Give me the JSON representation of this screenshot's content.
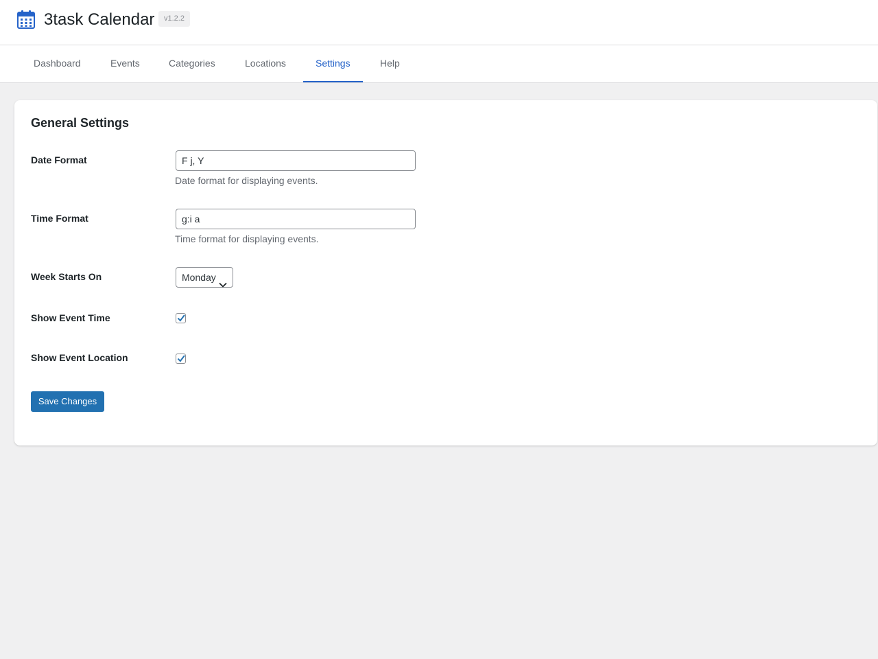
{
  "app": {
    "title": "3task Calendar",
    "version": "v1.2.2",
    "logo_icon": "calendar-icon",
    "accent_color": "#2563c9"
  },
  "nav": {
    "tabs": [
      {
        "label": "Dashboard",
        "active": false
      },
      {
        "label": "Events",
        "active": false
      },
      {
        "label": "Categories",
        "active": false
      },
      {
        "label": "Locations",
        "active": false
      },
      {
        "label": "Settings",
        "active": true
      },
      {
        "label": "Help",
        "active": false
      }
    ]
  },
  "settings": {
    "title": "General Settings",
    "date_format": {
      "label": "Date Format",
      "value": "F j, Y",
      "description": "Date format for displaying events."
    },
    "time_format": {
      "label": "Time Format",
      "value": "g:i a",
      "description": "Time format for displaying events."
    },
    "week_starts_on": {
      "label": "Week Starts On",
      "selected": "Monday",
      "icon": "chevron-down-icon"
    },
    "show_event_time": {
      "label": "Show Event Time",
      "checked": true
    },
    "show_event_location": {
      "label": "Show Event Location",
      "checked": true
    },
    "save_label": "Save Changes",
    "save_color": "#2271b1"
  }
}
